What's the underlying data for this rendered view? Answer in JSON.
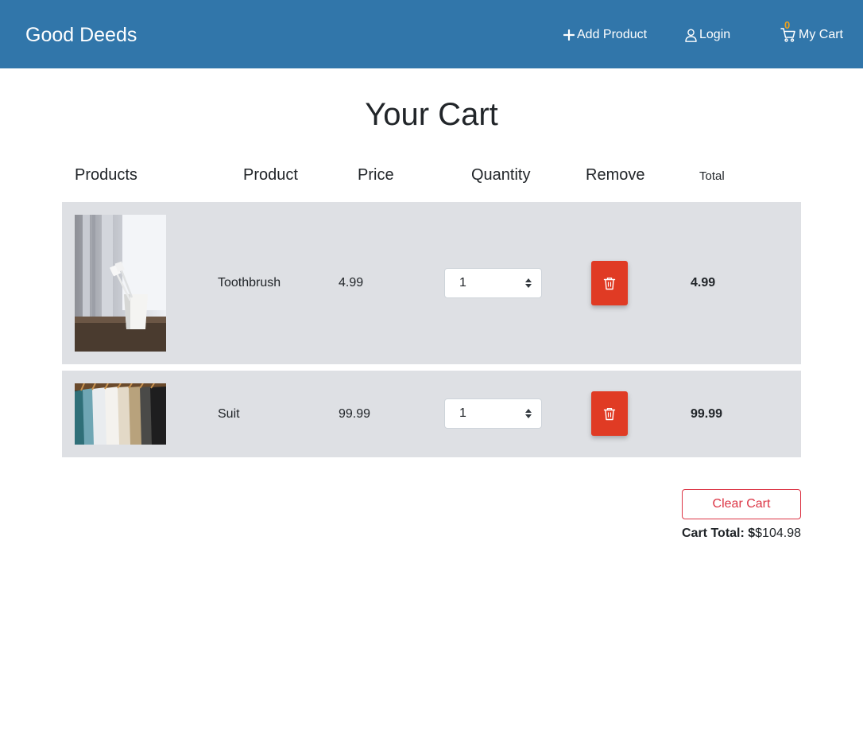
{
  "navbar": {
    "brand": "Good Deeds",
    "add_product": "Add Product",
    "login": "Login",
    "cart_label": "My Cart",
    "cart_count": "0",
    "bg_color": "#3176aa",
    "badge_color": "#f0a21a"
  },
  "page": {
    "title": "Your Cart"
  },
  "table": {
    "headers": {
      "products": "Products",
      "product": "Product",
      "price": "Price",
      "quantity": "Quantity",
      "remove": "Remove",
      "total": "Total"
    },
    "rows": [
      {
        "image": "toothbrush-photo",
        "name": "Toothbrush",
        "price": "4.99",
        "quantity": "1",
        "total": "4.99"
      },
      {
        "image": "suits-on-rack-photo",
        "name": "Suit",
        "price": "99.99",
        "quantity": "1",
        "total": "99.99"
      }
    ],
    "row_bg": "#dee0e4",
    "remove_button_color": "#e03b24"
  },
  "footer": {
    "clear_cart": "Clear Cart",
    "cart_total_label": "Cart Total: $",
    "cart_total_value": "$104.98"
  },
  "icons": {
    "add": "plus-icon",
    "login": "user-icon",
    "cart": "cart-icon",
    "remove": "trash-icon",
    "quantity": "select-arrows-icon"
  }
}
